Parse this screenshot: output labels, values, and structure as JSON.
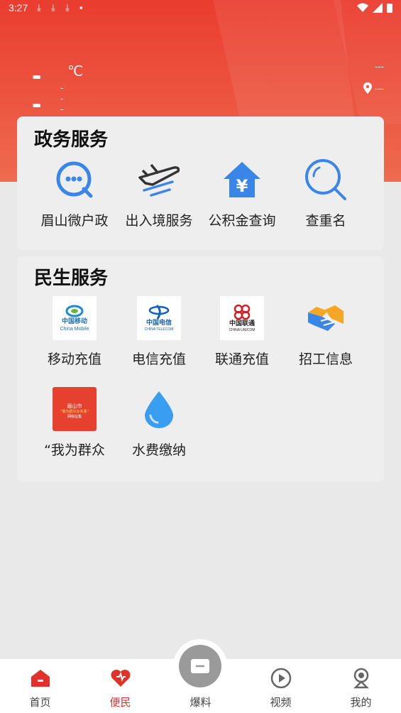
{
  "status_bar": {
    "time": "3:27"
  },
  "weather": {
    "temp": "--",
    "unit": "℃",
    "desc": "---",
    "right_top": "---",
    "location": "---"
  },
  "gov_services": {
    "title": "政务服务",
    "items": [
      {
        "label": "眉山微户政",
        "icon": "chat-bubble-icon"
      },
      {
        "label": "出入境服务",
        "icon": "airplane-icon"
      },
      {
        "label": "公积金查询",
        "icon": "house-yen-icon"
      },
      {
        "label": "查重名",
        "icon": "search-icon"
      }
    ]
  },
  "life_services": {
    "title": "民生服务",
    "items": [
      {
        "label": "移动充值",
        "icon": "china-mobile-logo"
      },
      {
        "label": "电信充值",
        "icon": "china-telecom-logo"
      },
      {
        "label": "联通充值",
        "icon": "china-unicom-logo"
      },
      {
        "label": "招工信息",
        "icon": "handshake-icon"
      },
      {
        "label": "“我为群众",
        "icon": "poster-thumbnail"
      },
      {
        "label": "水费缴纳",
        "icon": "water-drop-icon"
      }
    ],
    "logo_text": {
      "mobile_cn": "中国移动",
      "mobile_en": "China Mobile",
      "telecom_cn": "中国电信",
      "telecom_en": "CHINA TELECOM",
      "unicom_cn": "中国联通",
      "unicom_en": "CHINA UNICOM",
      "poster_line1": "眉山市",
      "poster_line2": "“我为群众办实事”",
      "poster_line3": "网络征集"
    }
  },
  "bottom_nav": {
    "items": [
      {
        "label": "首页",
        "icon": "home-icon"
      },
      {
        "label": "便民",
        "icon": "heart-icon",
        "active": true
      },
      {
        "label": "爆料",
        "icon": "mail-icon"
      },
      {
        "label": "视频",
        "icon": "play-icon"
      },
      {
        "label": "我的",
        "icon": "user-icon"
      }
    ]
  },
  "colors": {
    "accent": "#e0322a",
    "header": "#ea3d2f",
    "icon_blue": "#3a86e8"
  }
}
